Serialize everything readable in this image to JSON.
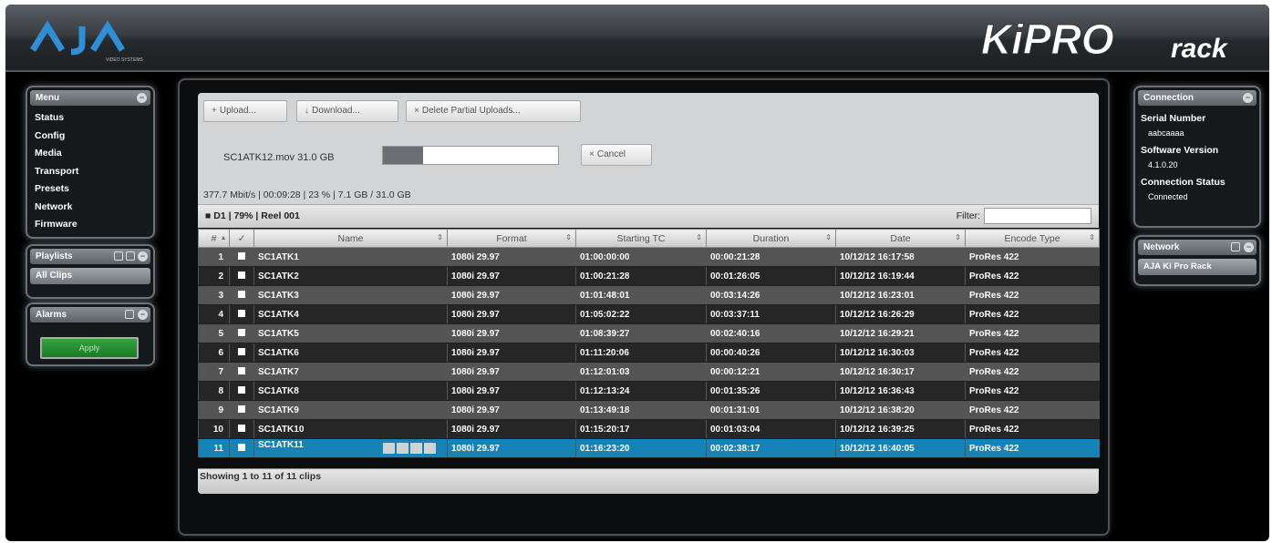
{
  "header": {
    "brand_left": "AJA",
    "brand_left_sub": "VIDEO SYSTEMS",
    "brand_right": "KiPRO",
    "brand_right_suffix": "rack"
  },
  "menu_panel": {
    "title": "Menu",
    "items": [
      "Status",
      "Config",
      "Media",
      "Transport",
      "Presets",
      "Network",
      "Firmware"
    ]
  },
  "playlists_panel": {
    "title": "Playlists",
    "active_item": "All Clips"
  },
  "alarms_panel": {
    "title": "Alarms",
    "button_label": "Apply"
  },
  "connection_panel": {
    "title": "Connection",
    "serial_label": "Serial Number",
    "serial_value": "aabcaaaa",
    "software_label": "Software Version",
    "software_value": "4.1.0.20",
    "status_label": "Connection Status",
    "status_value": "Connected"
  },
  "network_panel": {
    "title": "Network",
    "item": "AJA Ki Pro Rack"
  },
  "toolbar": {
    "upload_label": "Upload...",
    "download_label": "Download...",
    "delete_label": "Delete Partial Uploads..."
  },
  "transfer": {
    "file_info": "SC1ATK12.mov  31.0 GB",
    "progress": 0.23,
    "cancel_label": "Cancel",
    "stats": "377.7 Mbit/s | 00:09:28 | 23 % | 7.1 GB / 31.0 GB"
  },
  "reel_bar": {
    "text": "D1  |  79%  |  Reel 001",
    "filter_label": "Filter:",
    "filter_value": ""
  },
  "table": {
    "headers": [
      "#",
      "✓",
      "Name",
      "Format",
      "Starting TC",
      "Duration",
      "Date",
      "Encode Type"
    ],
    "rows": [
      {
        "n": "1",
        "name": "SC1ATK1",
        "format": "1080i 29.97",
        "tc": "01:00:00:00",
        "dur": "00:00:21:28",
        "date": "10/12/12 16:17:58",
        "enc": "ProRes 422"
      },
      {
        "n": "2",
        "name": "SC1ATK2",
        "format": "1080i 29.97",
        "tc": "01:00:21:28",
        "dur": "00:01:26:05",
        "date": "10/12/12 16:19:44",
        "enc": "ProRes 422"
      },
      {
        "n": "3",
        "name": "SC1ATK3",
        "format": "1080i 29.97",
        "tc": "01:01:48:01",
        "dur": "00:03:14:26",
        "date": "10/12/12 16:23:01",
        "enc": "ProRes 422"
      },
      {
        "n": "4",
        "name": "SC1ATK4",
        "format": "1080i 29.97",
        "tc": "01:05:02:22",
        "dur": "00:03:37:11",
        "date": "10/12/12 16:26:29",
        "enc": "ProRes 422"
      },
      {
        "n": "5",
        "name": "SC1ATK5",
        "format": "1080i 29.97",
        "tc": "01:08:39:27",
        "dur": "00:02:40:16",
        "date": "10/12/12 16:29:21",
        "enc": "ProRes 422"
      },
      {
        "n": "6",
        "name": "SC1ATK6",
        "format": "1080i 29.97",
        "tc": "01:11:20:06",
        "dur": "00:00:40:26",
        "date": "10/12/12 16:30:03",
        "enc": "ProRes 422"
      },
      {
        "n": "7",
        "name": "SC1ATK7",
        "format": "1080i 29.97",
        "tc": "01:12:01:03",
        "dur": "00:00:12:21",
        "date": "10/12/12 16:30:17",
        "enc": "ProRes 422"
      },
      {
        "n": "8",
        "name": "SC1ATK8",
        "format": "1080i 29.97",
        "tc": "01:12:13:24",
        "dur": "00:01:35:26",
        "date": "10/12/12 16:36:43",
        "enc": "ProRes 422"
      },
      {
        "n": "9",
        "name": "SC1ATK9",
        "format": "1080i 29.97",
        "tc": "01:13:49:18",
        "dur": "00:01:31:01",
        "date": "10/12/12 16:38:20",
        "enc": "ProRes 422"
      },
      {
        "n": "10",
        "name": "SC1ATK10",
        "format": "1080i 29.97",
        "tc": "01:15:20:17",
        "dur": "00:01:03:04",
        "date": "10/12/12 16:39:25",
        "enc": "ProRes 422"
      },
      {
        "n": "11",
        "name": "SC1ATK11",
        "format": "1080i 29.97",
        "tc": "01:16:23:20",
        "dur": "00:02:38:17",
        "date": "10/12/12 16:40:05",
        "enc": "ProRes 422"
      }
    ],
    "selected_row": 11,
    "footer": "Showing 1 to 11 of 11 clips"
  },
  "colors": {
    "selected_row": "#1583b5",
    "apply_green": "#2a9434",
    "panel_glow": "#9aa3ad"
  }
}
